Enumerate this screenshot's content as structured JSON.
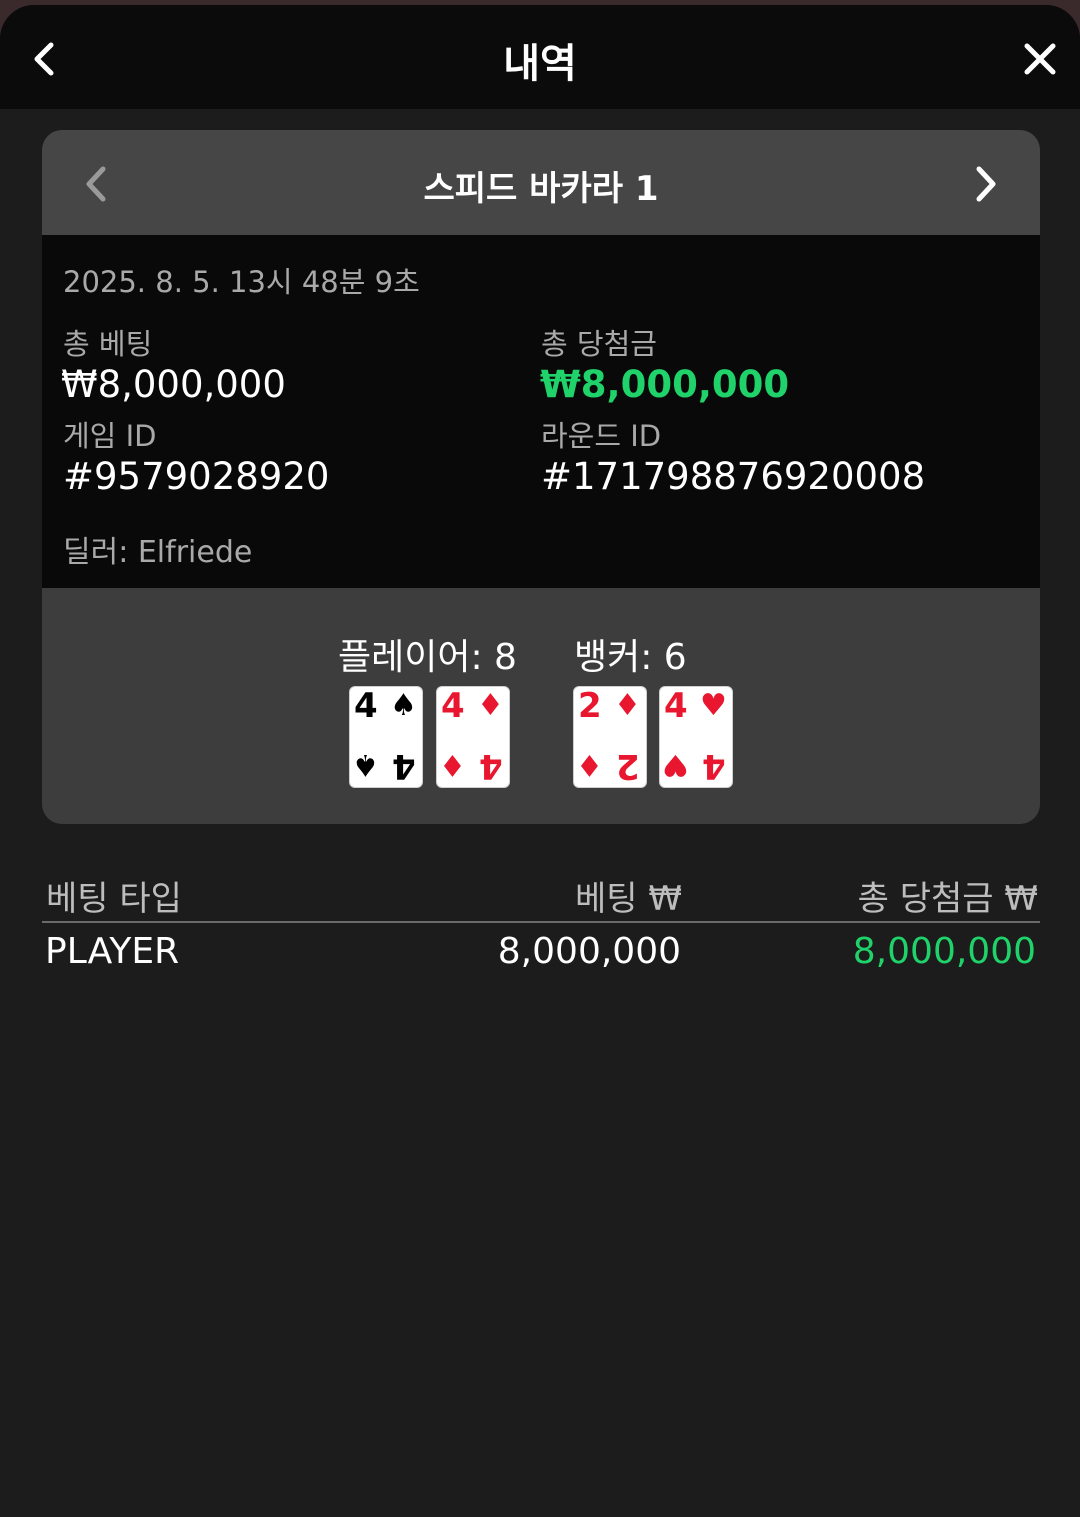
{
  "header": {
    "title": "내역",
    "back_icon": "chevron-left-icon",
    "close_icon": "close-icon"
  },
  "game": {
    "title": "스피드 바카라 1",
    "prev_icon": "chevron-left-icon",
    "next_icon": "chevron-right-icon"
  },
  "info": {
    "datetime": "2025. 8. 5. 13시 48분 9초",
    "total_bet_label": "총 베팅",
    "total_bet_value": "₩8,000,000",
    "total_win_label": "총 당첨금",
    "total_win_value": "₩8,000,000",
    "game_id_label": "게임 ID",
    "game_id_value": "#9579028920",
    "round_id_label": "라운드 ID",
    "round_id_value": "#171798876920008",
    "dealer": "딜러: Elfriede"
  },
  "result": {
    "player_score": "플레이어: 8",
    "banker_score": "뱅커: 6",
    "player_cards": [
      {
        "rank": "4",
        "suit": "♠",
        "color": "black"
      },
      {
        "rank": "4",
        "suit": "♦",
        "color": "red"
      }
    ],
    "banker_cards": [
      {
        "rank": "2",
        "suit": "♦",
        "color": "red"
      },
      {
        "rank": "4",
        "suit": "♥",
        "color": "red"
      }
    ]
  },
  "bets": {
    "columns": [
      "베팅 타입",
      "베팅 ₩",
      "총 당첨금 ₩"
    ],
    "rows": [
      {
        "type": "PLAYER",
        "bet": "8,000,000",
        "win": "8,000,000"
      }
    ]
  },
  "colors": {
    "accent_win": "#1fd26a",
    "card_red": "#e8162e"
  }
}
